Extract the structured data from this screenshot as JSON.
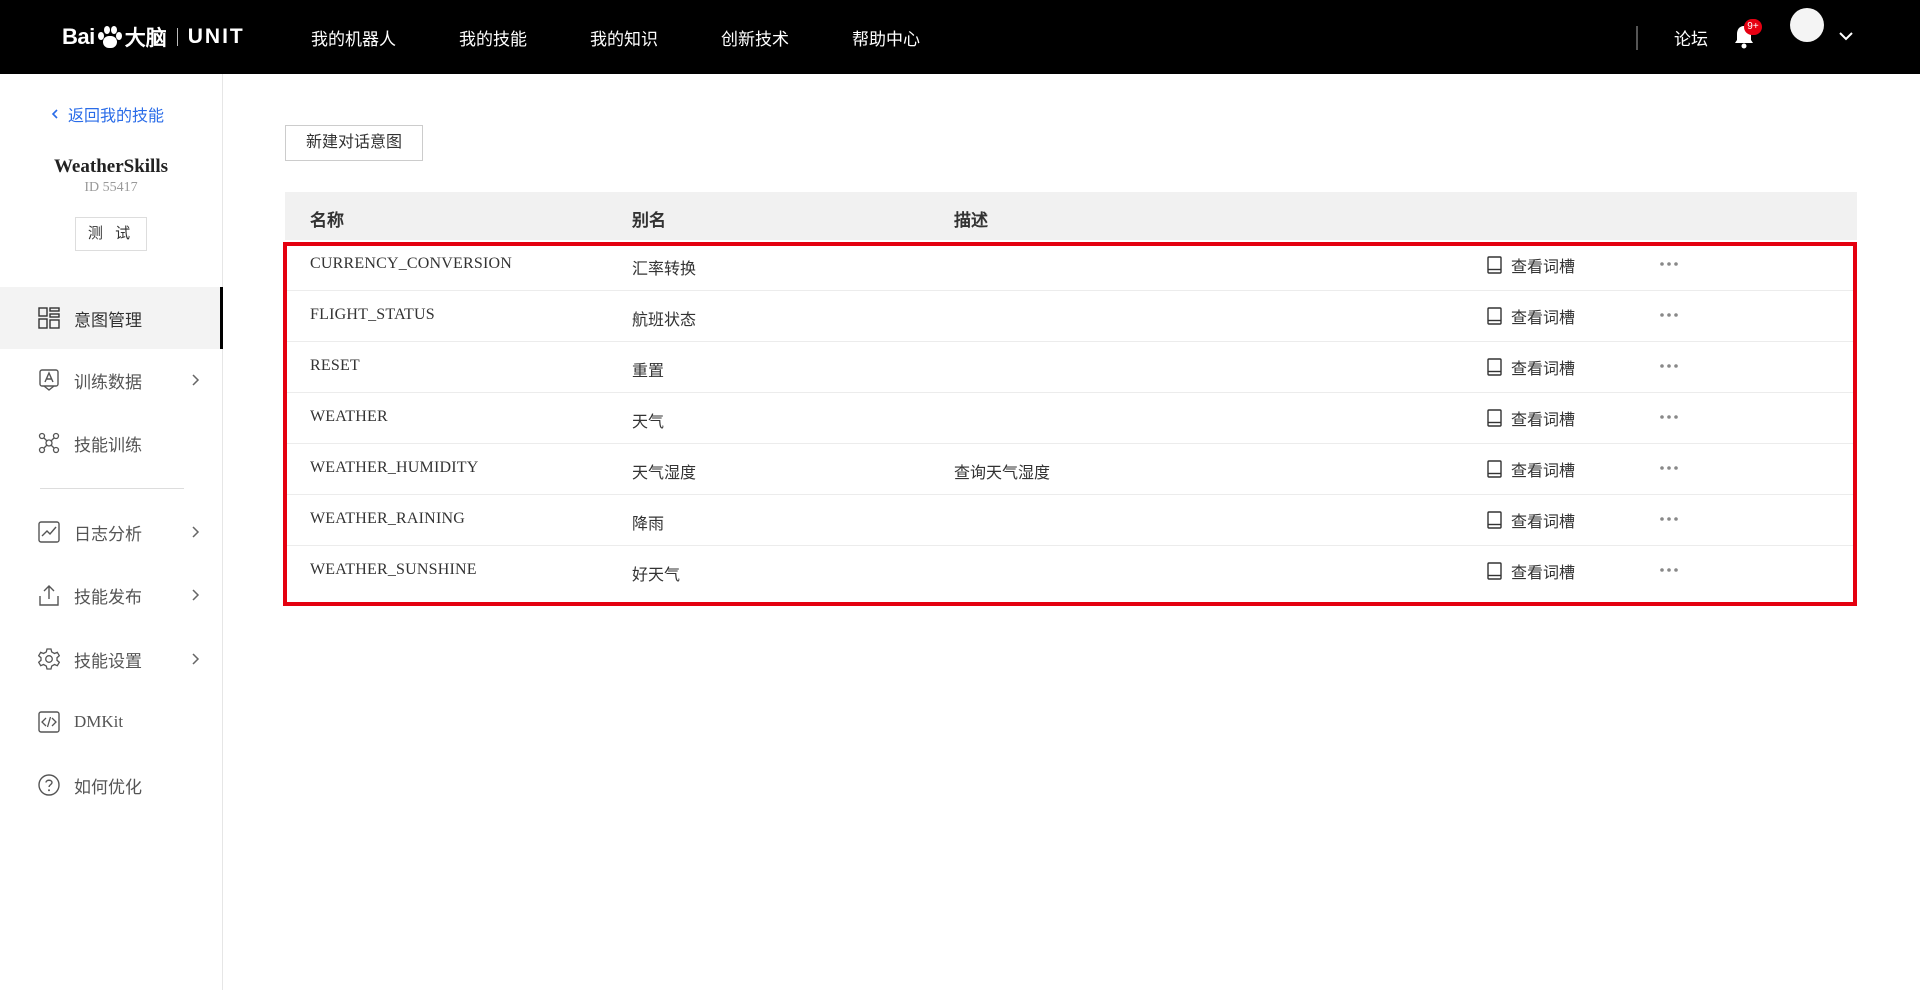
{
  "topbar": {
    "logo": {
      "baidu": "Bai",
      "brain": "大脑",
      "unit": "UNIT"
    },
    "nav": [
      "我的机器人",
      "我的技能",
      "我的知识",
      "创新技术",
      "帮助中心"
    ],
    "forum": "论坛",
    "notification_badge": "9+",
    "icons": [
      "bell-icon",
      "avatar",
      "chevron-down-icon"
    ]
  },
  "sidebar": {
    "back_label": "返回我的技能",
    "skill_name": "WeatherSkills",
    "skill_id": "ID 55417",
    "test_button": "测 试",
    "menu": [
      {
        "label": "意图管理",
        "icon": "intent-grid-icon",
        "active": true
      },
      {
        "label": "训练数据",
        "icon": "training-data-icon",
        "has_arrow": true
      },
      {
        "label": "技能训练",
        "icon": "network-icon"
      },
      {
        "label": "日志分析",
        "icon": "chart-icon",
        "has_arrow": true
      },
      {
        "label": "技能发布",
        "icon": "upload-icon",
        "has_arrow": true
      },
      {
        "label": "技能设置",
        "icon": "gear-icon",
        "has_arrow": true
      },
      {
        "label": "DMKit",
        "icon": "code-icon"
      },
      {
        "label": "如何优化",
        "icon": "help-icon"
      }
    ]
  },
  "main": {
    "new_intent_button": "新建对话意图",
    "columns": {
      "name": "名称",
      "alias": "别名",
      "desc": "描述"
    },
    "view_slot_label": "查看词槽",
    "rows": [
      {
        "name": "CURRENCY_CONVERSION",
        "alias": "汇率转换",
        "desc": ""
      },
      {
        "name": "FLIGHT_STATUS",
        "alias": "航班状态",
        "desc": ""
      },
      {
        "name": "RESET",
        "alias": "重置",
        "desc": ""
      },
      {
        "name": "WEATHER",
        "alias": "天气",
        "desc": ""
      },
      {
        "name": "WEATHER_HUMIDITY",
        "alias": "天气湿度",
        "desc": "查询天气湿度"
      },
      {
        "name": "WEATHER_RAINING",
        "alias": "降雨",
        "desc": ""
      },
      {
        "name": "WEATHER_SUNSHINE",
        "alias": "好天气",
        "desc": ""
      }
    ]
  },
  "colors": {
    "topbar": "#000000",
    "link": "#2a6ce8",
    "highlight": "#e4000f",
    "badge": "#e60012"
  }
}
